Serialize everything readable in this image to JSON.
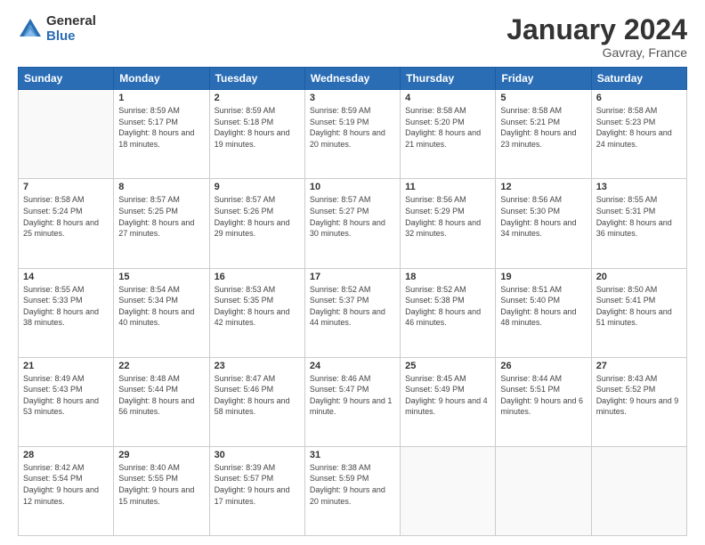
{
  "logo": {
    "general": "General",
    "blue": "Blue"
  },
  "title": "January 2024",
  "location": "Gavray, France",
  "headers": [
    "Sunday",
    "Monday",
    "Tuesday",
    "Wednesday",
    "Thursday",
    "Friday",
    "Saturday"
  ],
  "weeks": [
    [
      {
        "date": "",
        "sunrise": "",
        "sunset": "",
        "daylight": ""
      },
      {
        "date": "1",
        "sunrise": "Sunrise: 8:59 AM",
        "sunset": "Sunset: 5:17 PM",
        "daylight": "Daylight: 8 hours and 18 minutes."
      },
      {
        "date": "2",
        "sunrise": "Sunrise: 8:59 AM",
        "sunset": "Sunset: 5:18 PM",
        "daylight": "Daylight: 8 hours and 19 minutes."
      },
      {
        "date": "3",
        "sunrise": "Sunrise: 8:59 AM",
        "sunset": "Sunset: 5:19 PM",
        "daylight": "Daylight: 8 hours and 20 minutes."
      },
      {
        "date": "4",
        "sunrise": "Sunrise: 8:58 AM",
        "sunset": "Sunset: 5:20 PM",
        "daylight": "Daylight: 8 hours and 21 minutes."
      },
      {
        "date": "5",
        "sunrise": "Sunrise: 8:58 AM",
        "sunset": "Sunset: 5:21 PM",
        "daylight": "Daylight: 8 hours and 23 minutes."
      },
      {
        "date": "6",
        "sunrise": "Sunrise: 8:58 AM",
        "sunset": "Sunset: 5:23 PM",
        "daylight": "Daylight: 8 hours and 24 minutes."
      }
    ],
    [
      {
        "date": "7",
        "sunrise": "Sunrise: 8:58 AM",
        "sunset": "Sunset: 5:24 PM",
        "daylight": "Daylight: 8 hours and 25 minutes."
      },
      {
        "date": "8",
        "sunrise": "Sunrise: 8:57 AM",
        "sunset": "Sunset: 5:25 PM",
        "daylight": "Daylight: 8 hours and 27 minutes."
      },
      {
        "date": "9",
        "sunrise": "Sunrise: 8:57 AM",
        "sunset": "Sunset: 5:26 PM",
        "daylight": "Daylight: 8 hours and 29 minutes."
      },
      {
        "date": "10",
        "sunrise": "Sunrise: 8:57 AM",
        "sunset": "Sunset: 5:27 PM",
        "daylight": "Daylight: 8 hours and 30 minutes."
      },
      {
        "date": "11",
        "sunrise": "Sunrise: 8:56 AM",
        "sunset": "Sunset: 5:29 PM",
        "daylight": "Daylight: 8 hours and 32 minutes."
      },
      {
        "date": "12",
        "sunrise": "Sunrise: 8:56 AM",
        "sunset": "Sunset: 5:30 PM",
        "daylight": "Daylight: 8 hours and 34 minutes."
      },
      {
        "date": "13",
        "sunrise": "Sunrise: 8:55 AM",
        "sunset": "Sunset: 5:31 PM",
        "daylight": "Daylight: 8 hours and 36 minutes."
      }
    ],
    [
      {
        "date": "14",
        "sunrise": "Sunrise: 8:55 AM",
        "sunset": "Sunset: 5:33 PM",
        "daylight": "Daylight: 8 hours and 38 minutes."
      },
      {
        "date": "15",
        "sunrise": "Sunrise: 8:54 AM",
        "sunset": "Sunset: 5:34 PM",
        "daylight": "Daylight: 8 hours and 40 minutes."
      },
      {
        "date": "16",
        "sunrise": "Sunrise: 8:53 AM",
        "sunset": "Sunset: 5:35 PM",
        "daylight": "Daylight: 8 hours and 42 minutes."
      },
      {
        "date": "17",
        "sunrise": "Sunrise: 8:52 AM",
        "sunset": "Sunset: 5:37 PM",
        "daylight": "Daylight: 8 hours and 44 minutes."
      },
      {
        "date": "18",
        "sunrise": "Sunrise: 8:52 AM",
        "sunset": "Sunset: 5:38 PM",
        "daylight": "Daylight: 8 hours and 46 minutes."
      },
      {
        "date": "19",
        "sunrise": "Sunrise: 8:51 AM",
        "sunset": "Sunset: 5:40 PM",
        "daylight": "Daylight: 8 hours and 48 minutes."
      },
      {
        "date": "20",
        "sunrise": "Sunrise: 8:50 AM",
        "sunset": "Sunset: 5:41 PM",
        "daylight": "Daylight: 8 hours and 51 minutes."
      }
    ],
    [
      {
        "date": "21",
        "sunrise": "Sunrise: 8:49 AM",
        "sunset": "Sunset: 5:43 PM",
        "daylight": "Daylight: 8 hours and 53 minutes."
      },
      {
        "date": "22",
        "sunrise": "Sunrise: 8:48 AM",
        "sunset": "Sunset: 5:44 PM",
        "daylight": "Daylight: 8 hours and 56 minutes."
      },
      {
        "date": "23",
        "sunrise": "Sunrise: 8:47 AM",
        "sunset": "Sunset: 5:46 PM",
        "daylight": "Daylight: 8 hours and 58 minutes."
      },
      {
        "date": "24",
        "sunrise": "Sunrise: 8:46 AM",
        "sunset": "Sunset: 5:47 PM",
        "daylight": "Daylight: 9 hours and 1 minute."
      },
      {
        "date": "25",
        "sunrise": "Sunrise: 8:45 AM",
        "sunset": "Sunset: 5:49 PM",
        "daylight": "Daylight: 9 hours and 4 minutes."
      },
      {
        "date": "26",
        "sunrise": "Sunrise: 8:44 AM",
        "sunset": "Sunset: 5:51 PM",
        "daylight": "Daylight: 9 hours and 6 minutes."
      },
      {
        "date": "27",
        "sunrise": "Sunrise: 8:43 AM",
        "sunset": "Sunset: 5:52 PM",
        "daylight": "Daylight: 9 hours and 9 minutes."
      }
    ],
    [
      {
        "date": "28",
        "sunrise": "Sunrise: 8:42 AM",
        "sunset": "Sunset: 5:54 PM",
        "daylight": "Daylight: 9 hours and 12 minutes."
      },
      {
        "date": "29",
        "sunrise": "Sunrise: 8:40 AM",
        "sunset": "Sunset: 5:55 PM",
        "daylight": "Daylight: 9 hours and 15 minutes."
      },
      {
        "date": "30",
        "sunrise": "Sunrise: 8:39 AM",
        "sunset": "Sunset: 5:57 PM",
        "daylight": "Daylight: 9 hours and 17 minutes."
      },
      {
        "date": "31",
        "sunrise": "Sunrise: 8:38 AM",
        "sunset": "Sunset: 5:59 PM",
        "daylight": "Daylight: 9 hours and 20 minutes."
      },
      {
        "date": "",
        "sunrise": "",
        "sunset": "",
        "daylight": ""
      },
      {
        "date": "",
        "sunrise": "",
        "sunset": "",
        "daylight": ""
      },
      {
        "date": "",
        "sunrise": "",
        "sunset": "",
        "daylight": ""
      }
    ]
  ]
}
